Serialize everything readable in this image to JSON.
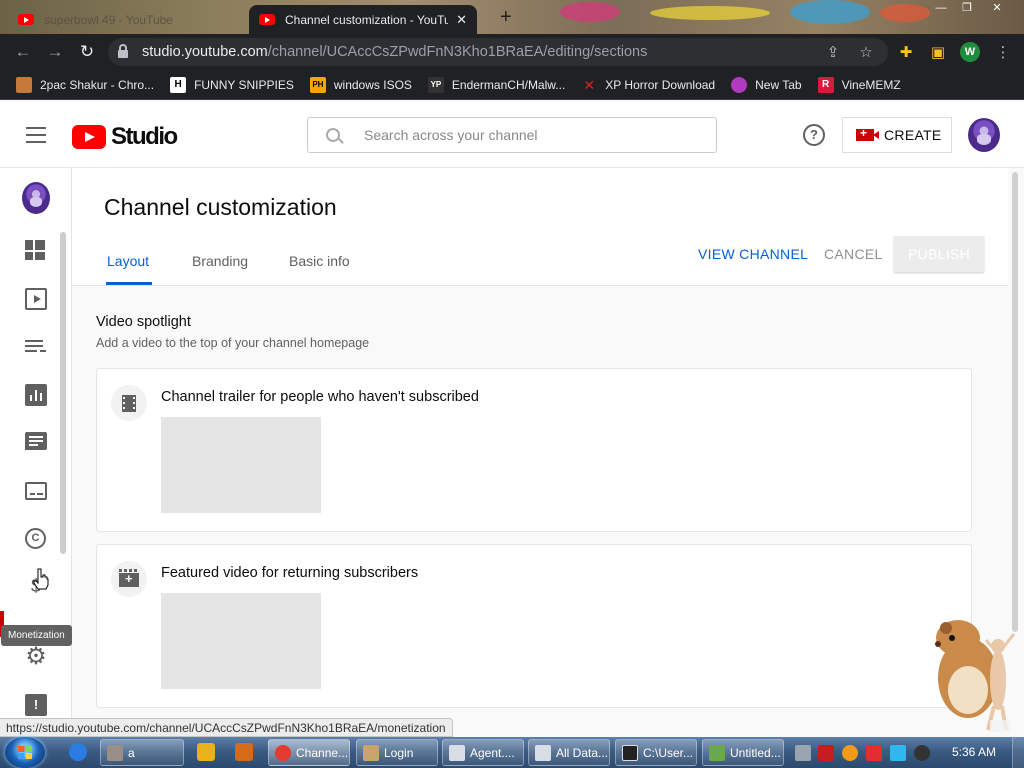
{
  "browser": {
    "tabs": [
      {
        "title": "superbowl 49 - YouTube",
        "active": false
      },
      {
        "title": "Channel customization - YouTube",
        "active": true
      }
    ],
    "url_host": "studio.youtube.com",
    "url_path": "/channel/UCAccCsZPwdFnN3Kho1BRaEA/editing/sections",
    "profile_initial": "W",
    "bookmarks": [
      {
        "label": "2pac Shakur - Chro...",
        "icon": "2pac-icon",
        "color": "#c47a3a"
      },
      {
        "label": "FUNNY SNIPPIES",
        "icon": "h-icon",
        "color": "#ffffff"
      },
      {
        "label": "windows ISOS",
        "icon": "ph-icon",
        "color": "#f7a600"
      },
      {
        "label": "EndermanCH/Malw...",
        "icon": "yp-icon",
        "color": "#333333"
      },
      {
        "label": "XP Horror Download",
        "icon": "x-icon",
        "color": "#e02020"
      },
      {
        "label": "New Tab",
        "icon": "globe-icon",
        "color": "#b03ac0"
      },
      {
        "label": "VineMEMZ",
        "icon": "r-icon",
        "color": "#d81b3c"
      }
    ],
    "status_url": "https://studio.youtube.com/channel/UCAccCsZPwdFnN3Kho1BRaEA/monetization"
  },
  "studio": {
    "logo_text": "Studio",
    "search_placeholder": "Search across your channel",
    "create_label": "CREATE",
    "nav_tooltip": "Monetization",
    "nav_icons": [
      "dashboard-icon",
      "content-icon",
      "playlists-icon",
      "analytics-icon",
      "comments-icon",
      "subtitles-icon",
      "copyright-icon",
      "monetization-icon",
      "settings-icon",
      "feedback-icon"
    ]
  },
  "page": {
    "title": "Channel customization",
    "tabs": [
      "Layout",
      "Branding",
      "Basic info"
    ],
    "active_tab": "Layout",
    "actions": {
      "view_channel": "VIEW CHANNEL",
      "cancel": "CANCEL",
      "publish": "PUBLISH"
    },
    "section": {
      "title": "Video spotlight",
      "subtitle": "Add a video to the top of your channel homepage",
      "cards": [
        {
          "title": "Channel trailer for people who haven't subscribed",
          "icon": "film-icon"
        },
        {
          "title": "Featured video for returning subscribers",
          "icon": "featured-video-icon"
        }
      ]
    }
  },
  "taskbar": {
    "items": [
      {
        "label": "a",
        "active": false
      },
      {
        "label": "Channe...",
        "active": true
      },
      {
        "label": "Login",
        "active": false
      },
      {
        "label": "Agent....",
        "active": false
      },
      {
        "label": "All Data...",
        "active": false
      },
      {
        "label": "C:\\User...",
        "active": false
      },
      {
        "label": "Untitled...",
        "active": false
      }
    ],
    "clock": "5:36 AM"
  }
}
